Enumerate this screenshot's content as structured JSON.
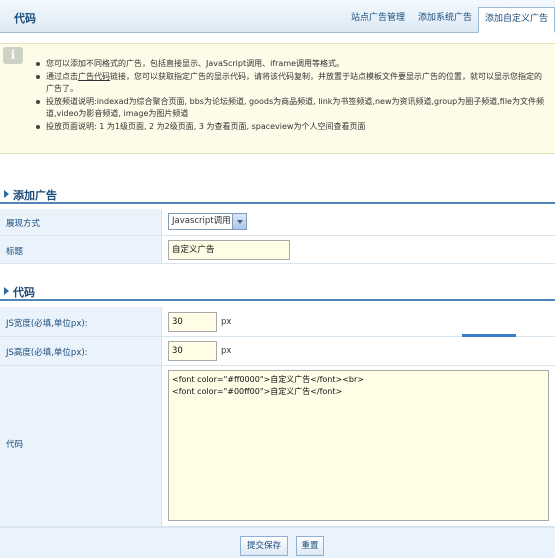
{
  "header": {
    "title": "代码",
    "tabs": [
      {
        "label": "站点广告管理"
      },
      {
        "label": "添加系统广告"
      },
      {
        "label": "添加自定义广告"
      }
    ]
  },
  "info": {
    "icon_name": "info-icon",
    "items": [
      "您可以添加不同格式的广告，包括直接显示、JavaScript调用、iframe调用等格式。",
      "通过点击",
      "广告代码",
      "链接，您可以获取指定广告的显示代码，请将该代码复制，并放置于站点模板文件要显示广告的位置，就可以显示您指定的广告了。",
      "投放频道说明:indexad为综合聚合页面, bbs为论坛频道, goods为商品频道, link为书签频道,new为资讯频道,group为圈子频道,file为文件频道,video为影音频道, image为图片频道",
      "投放页面说明: 1 为1级页面, 2 为2级页面, 3 为查看页面, spaceview为个人空间查看页面"
    ]
  },
  "section_add": {
    "label": "添加广告"
  },
  "form_add": {
    "display_label": "展现方式",
    "display_value": "Javascript调用",
    "title_label": "标题",
    "title_value": "自定义广告"
  },
  "section_code": {
    "label": "代码"
  },
  "form_code": {
    "width_label": "JS宽度(必填,单位px):",
    "width_value": "30",
    "width_unit": "px",
    "height_label": "JS高度(必填,单位px):",
    "height_value": "30",
    "height_unit": "px",
    "code_label": "代码",
    "code_line1": "<font color=\"#ff0000\">自定义广告</font><br>",
    "code_line2": "<font color=\"#00ff00\">自定义广告</font>"
  },
  "buttons": {
    "submit": "提交保存",
    "reset": "重置"
  },
  "colors": {
    "accent": "#1b4c7a",
    "section_line": "#4e86b8",
    "label_bg": "#eaf2fb",
    "info_bg": "#fdfce8"
  }
}
